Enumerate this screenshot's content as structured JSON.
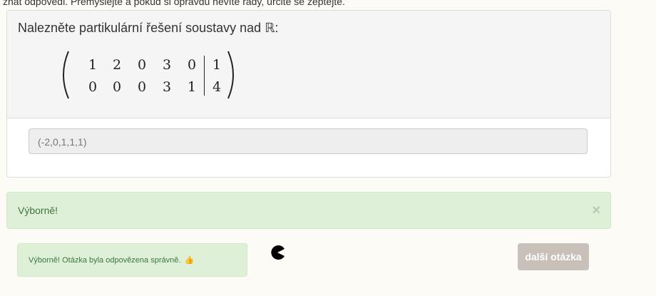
{
  "intro_text": "znát odpovědi. Přemýšlejte a pokud si opravdu nevíte rady, určitě se zeptejte.",
  "question": {
    "text": "Nalezněte partikulární řešení soustavy nad ℝ:"
  },
  "matrix": {
    "rows": [
      [
        "1",
        "2",
        "0",
        "3",
        "0"
      ],
      [
        "0",
        "0",
        "0",
        "3",
        "1"
      ]
    ],
    "rhs": [
      "1",
      "4"
    ]
  },
  "answer": {
    "value": "(-2,0,1,1,1)"
  },
  "alert": {
    "text": "Výborně!",
    "close_glyph": "×"
  },
  "feedback": {
    "text": "Výborně! Otázka byla odpovězena správně.",
    "icon": "thumbs-up-icon"
  },
  "next_button": {
    "label": "další otázka"
  },
  "colors": {
    "success_bg": "#dff0d8",
    "success_text": "#3c763d",
    "button_bg": "#c9c0b9"
  }
}
